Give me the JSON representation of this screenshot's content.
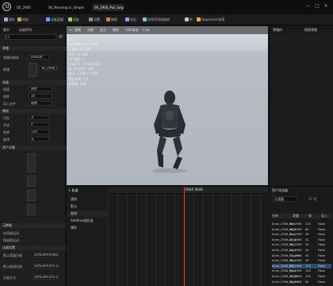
{
  "window": {
    "tabs": [
      "DS_2906",
      "SK_Mannequin_Simple",
      "SK_2906_Pull_Sequencer"
    ],
    "controls": [
      "—",
      "□",
      "✕"
    ]
  },
  "toolbar": {
    "items": [
      "保存",
      "浏览",
      "动画蓝图",
      "渲染",
      "设置",
      "捕获",
      "导出",
      "向序列添加相机",
      "IK",
      "Sequencer选项"
    ]
  },
  "details": {
    "tabs": [
      "细节",
      "动画序列"
    ],
    "search_placeholder": "搜索",
    "sections": [
      "骨骼",
      "动画",
      "播放",
      "资产详情",
      "元数据",
      "压缩设置"
    ],
    "rows": [
      {
        "label": "骨骼网格体",
        "value": "Default"
      },
      {
        "label": "骨骼",
        "value": "SK_2906_Full"
      },
      {
        "label": "插值",
        "value": "线性"
      },
      {
        "label": "帧率",
        "value": "30"
      },
      {
        "label": "导入文件",
        "value": "帧数"
      },
      {
        "label": "目标",
        "value": "开"
      },
      {
        "label": "开始",
        "value": "0"
      },
      {
        "label": "结束",
        "value": "120"
      },
      {
        "label": "曲线",
        "value": "无"
      },
      {
        "label": "启用根运动",
        "value": ""
      },
      {
        "label": "保留根运动",
        "value": ""
      },
      {
        "label": "默认骨骼压缩",
        "value": "DefaultAnimBoneCompre"
      },
      {
        "label": "默认曲线压缩",
        "value": "DefaultAnimCurveCompre"
      },
      {
        "label": "压缩方法",
        "value": "DefaultAnimCurveCompre"
      }
    ]
  },
  "viewport": {
    "buttons": [
      "透视",
      "光照",
      "显示",
      "角色",
      "LOD自动",
      "1.0x"
    ],
    "stats": [
      "LOD: 0",
      "当前屏幕尺寸: 1.003",
      "三角形: 31,648",
      "顶点: 18,764",
      "UV 通道: 1",
      "近似尺寸: 67x48x183",
      "帧: 45.000 / 120",
      "时间: 1.500 / 4.000",
      "播放速率: 1.0",
      "根骨骼: 位移"
    ]
  },
  "sequencer": {
    "add_label": "+ 轨道",
    "tracks": [
      "通知",
      "默认",
      "曲线",
      "Additive层轨道",
      "属性"
    ],
    "frame_label": "0045 0046"
  },
  "asset_browser": {
    "tabs": [
      "资产浏览器"
    ],
    "filter": "过滤器",
    "count": "37 项",
    "columns": [
      "名称",
      "骨骼",
      "帧",
      "导入"
    ],
    "rows": [
      [
        "Anim_2906_Idle",
        "SK_2906",
        "120",
        "False"
      ],
      [
        "Anim_2906_Walk",
        "SK_2906",
        "60",
        "False"
      ],
      [
        "Anim_2906_Run",
        "SK_2906",
        "40",
        "False"
      ],
      [
        "Anim_2906_Jump",
        "SK_2906",
        "52",
        "False"
      ],
      [
        "Anim_2906_Fall",
        "SK_2906",
        "30",
        "False"
      ],
      [
        "Anim_2906_Land",
        "SK_2906",
        "24",
        "False"
      ],
      [
        "Anim_2906_Crouch",
        "SK_2906",
        "90",
        "False"
      ],
      [
        "Anim_2906_Turn",
        "SK_2906",
        "45",
        "False"
      ],
      [
        "Anim_2906_Pull",
        "SK_2906",
        "120",
        "False"
      ],
      [
        "Anim_2906_Push",
        "SK_2906",
        "100",
        "False"
      ],
      [
        "Anim_2906_Climb",
        "SK_2906",
        "150",
        "False"
      ],
      [
        "Anim_2906_Death",
        "SK_2906",
        "80",
        "False"
      ]
    ]
  },
  "right_header": [
    "骨骼树",
    "搜索骨骼"
  ]
}
